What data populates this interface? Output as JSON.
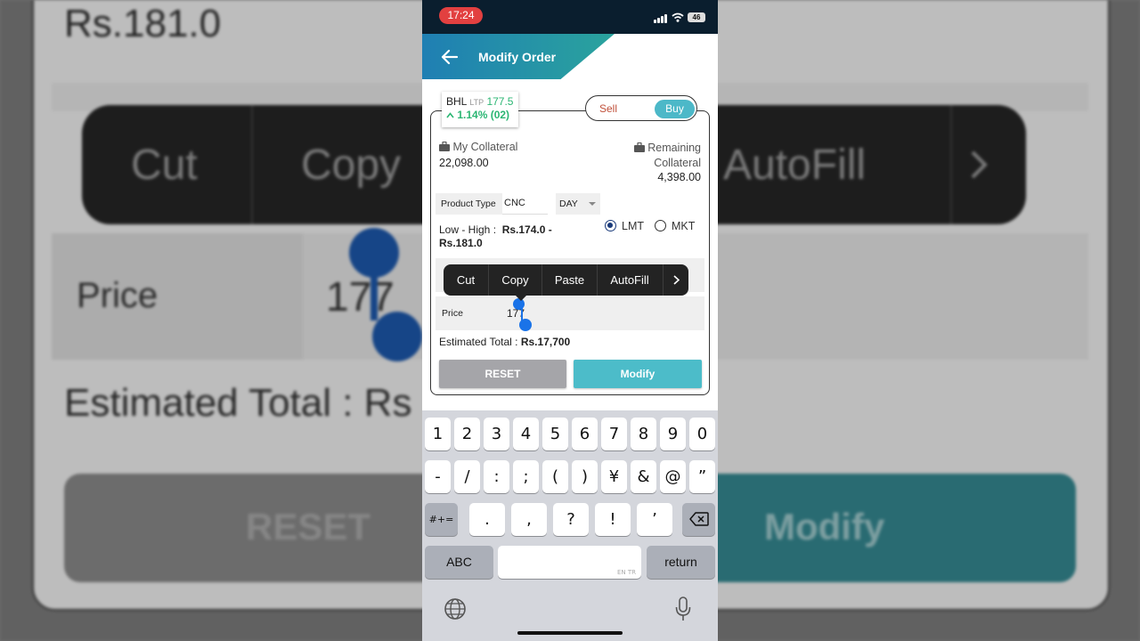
{
  "background": {
    "price_display": "Rs.181.0",
    "menu_items": [
      "Cut",
      "Copy",
      "AutoFill"
    ],
    "price_label": "Price",
    "price_value": "177",
    "estimated_label": "Estimated Total : Rs",
    "reset_label": "RESET",
    "modify_label": "Modify"
  },
  "status_bar": {
    "time": "17:24",
    "battery": "46"
  },
  "app_bar": {
    "title": "Modify Order"
  },
  "stock": {
    "symbol": "BHL",
    "ltp_tag": "LTP",
    "ltp": "177.5",
    "change": "1.14% (02)"
  },
  "side_toggle": {
    "sell": "Sell",
    "buy": "Buy",
    "selected": "Buy"
  },
  "collateral": {
    "my_label": "My Collateral",
    "my_value": "22,098.00",
    "remaining_label_1": "Remaining",
    "remaining_label_2": "Collateral",
    "remaining_value": "4,398.00"
  },
  "product": {
    "label": "Product Type",
    "value": "CNC",
    "validity": "DAY"
  },
  "range": {
    "label": "Low - High :",
    "low": "Rs.174.0 -",
    "high": "Rs.181.0"
  },
  "order_type": {
    "options": [
      "LMT",
      "MKT"
    ],
    "selected": "LMT"
  },
  "context_menu": {
    "items": [
      "Cut",
      "Copy",
      "Paste",
      "AutoFill"
    ]
  },
  "price": {
    "label": "Price",
    "value": "177"
  },
  "estimate": {
    "label": "Estimated Total :",
    "value": "Rs.17,700"
  },
  "buttons": {
    "reset": "RESET",
    "modify": "Modify"
  },
  "keyboard": {
    "row1": [
      "1",
      "2",
      "3",
      "4",
      "5",
      "6",
      "7",
      "8",
      "9",
      "0"
    ],
    "row2": [
      "-",
      "/",
      ":",
      ";",
      "(",
      ")",
      "¥",
      "&",
      "@",
      "”"
    ],
    "row3_left": "#+=",
    "row3": [
      ".",
      ",",
      "?",
      "!",
      "’"
    ],
    "abc": "ABC",
    "space_lang": "EN TR",
    "return": "return"
  },
  "colors": {
    "accent": "#4cbcc9",
    "status_red": "#e24040",
    "gain_green": "#2bb673",
    "sell_red": "#c0503a"
  }
}
